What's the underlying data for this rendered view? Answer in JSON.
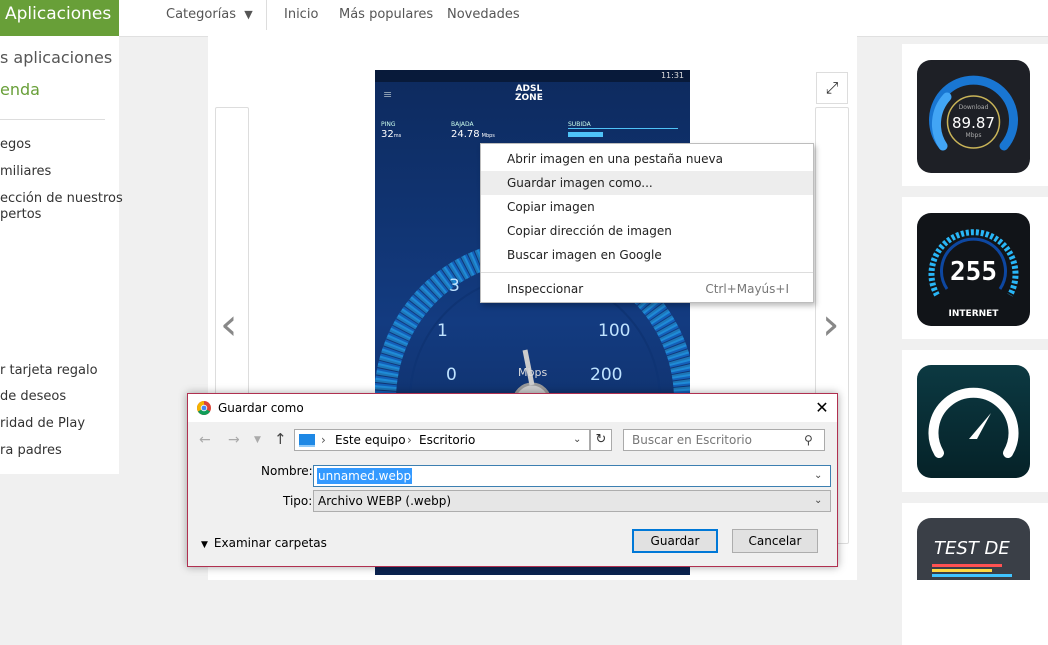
{
  "topbar": {
    "brand": "Aplicaciones",
    "nav": {
      "categories": "Categorías",
      "home": "Inicio",
      "popular": "Más populares",
      "new": "Novedades"
    }
  },
  "left_panel": {
    "title": "s aplicaciones",
    "store": "enda",
    "items_top": [
      "egos",
      "miliares",
      "ección de nuestros",
      "pertos"
    ],
    "items_bottom": [
      "r tarjeta regalo",
      "de deseos",
      "ridad de Play",
      "ra padres"
    ]
  },
  "screenshot_app": {
    "logo_line1": "ADSL",
    "logo_line2": "ZONE",
    "time": "11:31",
    "ping_label": "PING",
    "ping_value": "32",
    "ping_unit": "ms",
    "download_label": "BAJADA",
    "download_value": "24.78",
    "download_unit": "Mbps",
    "upload_label": "SUBIDA",
    "gauge_ticks": [
      "3",
      "1",
      "0",
      "100",
      "200"
    ],
    "gauge_unit": "Mbps"
  },
  "context_menu": {
    "items": [
      "Abrir imagen en una pestaña nueva",
      "Guardar imagen como...",
      "Copiar imagen",
      "Copiar dirección de imagen",
      "Buscar imagen en Google"
    ],
    "inspect": "Inspeccionar",
    "inspect_shortcut": "Ctrl+Mayús+I"
  },
  "right_apps": {
    "app1_top": "Download",
    "app1_value": "89.87",
    "app1_unit": "Mbps",
    "app2_value": "255",
    "app2_label": "INTERNET",
    "app4_label": "TEST DE"
  },
  "dialog": {
    "title": "Guardar como",
    "breadcrumb_pc": "Este equipo",
    "breadcrumb_folder": "Escritorio",
    "search_placeholder": "Buscar en Escritorio",
    "name_label": "Nombre:",
    "name_value": "unnamed.webp",
    "type_label": "Tipo:",
    "type_value": "Archivo WEBP (.webp)",
    "browse_folders": "Examinar carpetas",
    "save": "Guardar",
    "cancel": "Cancelar"
  },
  "colors": {
    "brand": "#689f38",
    "dialog_border": "#b03050",
    "selection": "#3399ff",
    "gauge_blue": "#29b6f6"
  }
}
